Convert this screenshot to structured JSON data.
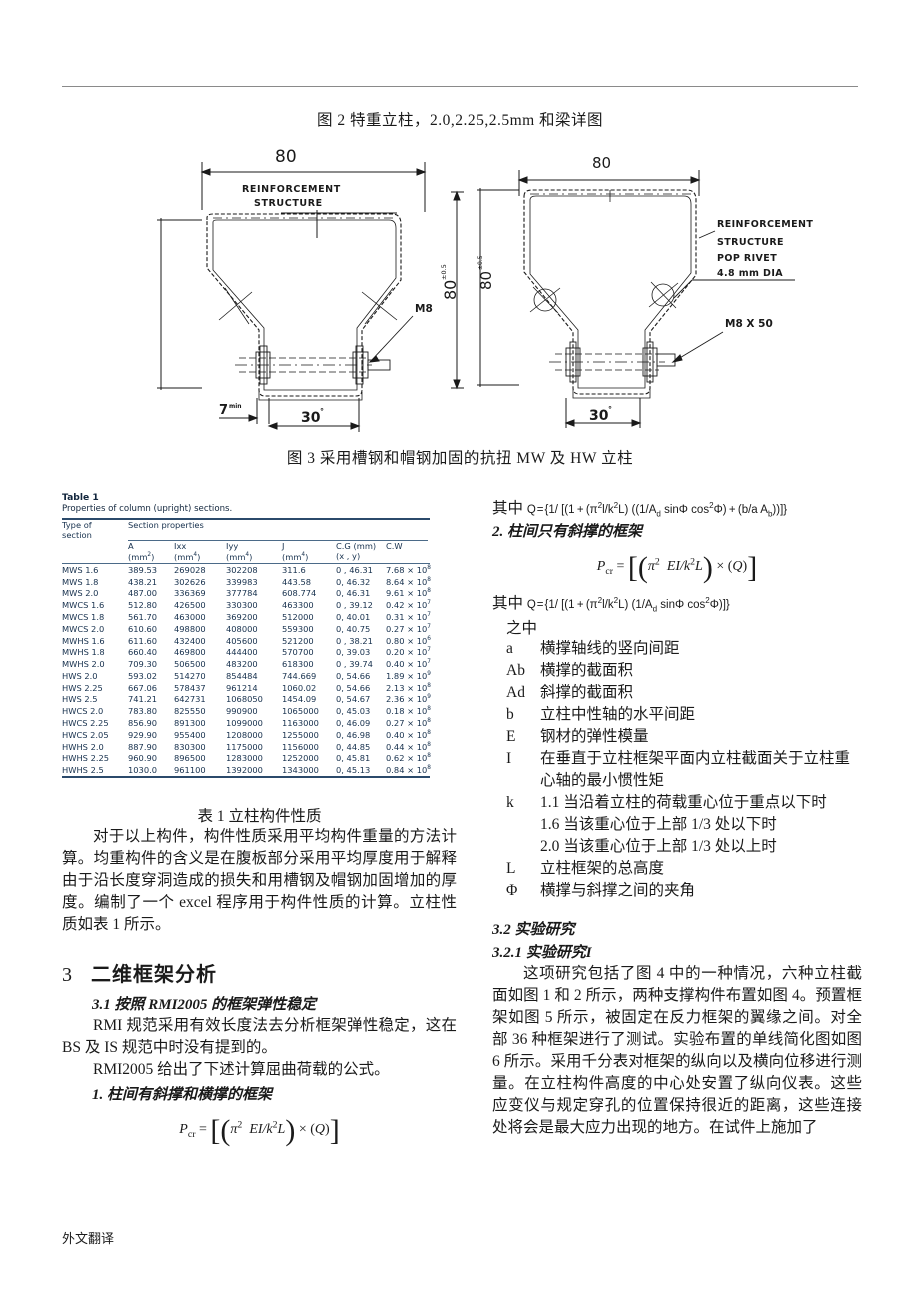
{
  "document": {
    "footer_label": "外文翻译"
  },
  "figures": {
    "fig2_caption": "图 2 特重立柱，2.0,2.25,2.5mm 和梁详图",
    "fig3_caption": "图 3 采用槽钢和帽钢加固的抗扭 MW 及 HW 立柱",
    "left_drawing": {
      "name": "MW 立柱断面图",
      "dim_top": "80",
      "dim_right": "80",
      "dim_right_sup": "±0.5",
      "label_reinforcement": "REINFORCEMENT",
      "label_structure": "STRUCTURE",
      "label_bolt": "M8",
      "dim_bottom_left": "7",
      "dim_bottom_left_sup": "min",
      "dim_bottom": "30",
      "dim_bottom_sup": "°"
    },
    "right_drawing": {
      "name": "HW 立柱断面图",
      "dim_top": "80",
      "dim_left": "80",
      "dim_left_sup": "±0.5",
      "label_reinforcement": "REINFORCEMENT",
      "label_structure": "STRUCTURE",
      "label_rivet": "POP RIVET",
      "label_rivet_dia": "4.8 mm DIA",
      "label_bolt": "M8 X 50",
      "dim_bottom": "30",
      "dim_bottom_sup": "°"
    }
  },
  "table1": {
    "label": "Table 1",
    "subtitle": "Properties of column (upright) sections.",
    "header_col0_line1": "Type of",
    "header_col0_line2": "section",
    "header_group": "Section properties",
    "columns": [
      {
        "sym": "A",
        "unit_pre": "(mm",
        "unit_sup": "2",
        "unit_post": ")"
      },
      {
        "sym": "Ixx",
        "unit_pre": "(mm",
        "unit_sup": "4",
        "unit_post": ")"
      },
      {
        "sym": "Iyy",
        "unit_pre": "(mm",
        "unit_sup": "4",
        "unit_post": ")"
      },
      {
        "sym": "J",
        "unit_pre": "(mm",
        "unit_sup": "4",
        "unit_post": ")"
      },
      {
        "sym": "C.G (mm)",
        "unit_pre": "(x , y)",
        "unit_sup": "",
        "unit_post": ""
      },
      {
        "sym": "C.W",
        "unit_pre": "",
        "unit_sup": "",
        "unit_post": ""
      }
    ],
    "rows": [
      {
        "type": "MWS 1.6",
        "a": "389.53",
        "ixx": "269028",
        "iyy": "302208",
        "j": "311.6",
        "cg": "0 , 46.31",
        "cw_m": "7.68",
        "cw_e": "8"
      },
      {
        "type": "MWS 1.8",
        "a": "438.21",
        "ixx": "302626",
        "iyy": "339983",
        "j": "443.58",
        "cg": "0, 46.32",
        "cw_m": "8.64",
        "cw_e": "8"
      },
      {
        "type": "MWS 2.0",
        "a": "487.00",
        "ixx": "336369",
        "iyy": "377784",
        "j": "608.774",
        "cg": "0, 46.31",
        "cw_m": "9.61",
        "cw_e": "8"
      },
      {
        "type": "MWCS 1.6",
        "a": "512.80",
        "ixx": "426500",
        "iyy": "330300",
        "j": "463300",
        "cg": "0 , 39.12",
        "cw_m": "0.42",
        "cw_e": "7"
      },
      {
        "type": "MWCS 1.8",
        "a": "561.70",
        "ixx": "463000",
        "iyy": "369200",
        "j": "512000",
        "cg": "0, 40.01",
        "cw_m": "0.31",
        "cw_e": "7"
      },
      {
        "type": "MWCS 2.0",
        "a": "610.60",
        "ixx": "498800",
        "iyy": "408000",
        "j": "559300",
        "cg": "0, 40.75",
        "cw_m": "0.27",
        "cw_e": "7"
      },
      {
        "type": "MWHS 1.6",
        "a": "611.60",
        "ixx": "432400",
        "iyy": "405600",
        "j": "521200",
        "cg": "0 , 38.21",
        "cw_m": "0.80",
        "cw_e": "6"
      },
      {
        "type": "MWHS 1.8",
        "a": "660.40",
        "ixx": "469800",
        "iyy": "444400",
        "j": "570700",
        "cg": "0, 39.03",
        "cw_m": "0.20",
        "cw_e": "7"
      },
      {
        "type": "MWHS 2.0",
        "a": "709.30",
        "ixx": "506500",
        "iyy": "483200",
        "j": "618300",
        "cg": "0 , 39.74",
        "cw_m": "0.40",
        "cw_e": "7"
      },
      {
        "type": "HWS 2.0",
        "a": "593.02",
        "ixx": "514270",
        "iyy": "854484",
        "j": "744.669",
        "cg": "0, 54.66",
        "cw_m": "1.89",
        "cw_e": "9"
      },
      {
        "type": "HWS 2.25",
        "a": "667.06",
        "ixx": "578437",
        "iyy": "961214",
        "j": "1060.02",
        "cg": "0, 54.66",
        "cw_m": "2.13",
        "cw_e": "8"
      },
      {
        "type": "HWS 2.5",
        "a": "741.21",
        "ixx": "642731",
        "iyy": "1068050",
        "j": "1454.09",
        "cg": "0, 54.67",
        "cw_m": "2.36",
        "cw_e": "9"
      },
      {
        "type": "HWCS 2.0",
        "a": "783.80",
        "ixx": "825550",
        "iyy": "990900",
        "j": "1065000",
        "cg": "0, 45.03",
        "cw_m": "0.18",
        "cw_e": "8"
      },
      {
        "type": "HWCS 2.25",
        "a": "856.90",
        "ixx": "891300",
        "iyy": "1099000",
        "j": "1163000",
        "cg": "0, 46.09",
        "cw_m": "0.27",
        "cw_e": "8"
      },
      {
        "type": "HWCS 2.05",
        "a": "929.90",
        "ixx": "955400",
        "iyy": "1208000",
        "j": "1255000",
        "cg": "0, 46.98",
        "cw_m": "0.40",
        "cw_e": "8"
      },
      {
        "type": "HWHS 2.0",
        "a": "887.90",
        "ixx": "830300",
        "iyy": "1175000",
        "j": "1156000",
        "cg": "0, 44.85",
        "cw_m": "0.44",
        "cw_e": "8"
      },
      {
        "type": "HWHS 2.25",
        "a": "960.90",
        "ixx": "896500",
        "iyy": "1283000",
        "j": "1252000",
        "cg": "0, 45.81",
        "cw_m": "0.62",
        "cw_e": "8"
      },
      {
        "type": "HWHS 2.5",
        "a": "1030.0",
        "ixx": "961100",
        "iyy": "1392000",
        "j": "1343000",
        "cg": "0, 45.13",
        "cw_m": "0.84",
        "cw_e": "8"
      }
    ]
  },
  "left_column": {
    "table_caption": "表 1 立柱构件性质",
    "para1": "对于以上构件，构件性质采用平均构件重量的方法计算。均重构件的含义是在腹板部分采用平均厚度用于解释由于沿长度穿洞造成的损失和用槽钢及帽钢加固增加的厚度。编制了一个 excel 程序用于构件性质的计算。立柱性质如表 1 所示。",
    "section_num": "3",
    "section_title": "二维框架分析",
    "subsection_31": "3.1 按照 RMI2005 的框架弹性稳定",
    "para2": "RMI 规范采用有效长度法去分析框架弹性稳定，这在 BS 及 IS 规范中时没有提到的。",
    "para3": "RMI2005 给出了下述计算屈曲荷载的公式。",
    "item1": "1. 柱间有斜撑和横撑的框架",
    "formula1": "Pcr = [ (π² EI/k²L) × (Q) ]"
  },
  "right_column": {
    "qizhong1_label": "其中",
    "qizhong1_formula": "Q = {1/ [(1 + (π²l/k²L) ((1/Ad sinΦ cos²Φ) + (b/a Ab))]}",
    "item2": "2. 柱间只有斜撑的框架",
    "formula2": "Pcr = [ (π² EI/k²L) × (Q) ]",
    "qizhong2_label": "其中",
    "qizhong2_formula": "Q = {1/ [(1 + (π²l/k²L) (1/Ad sinΦ cos²Φ)]}",
    "zhizhong": "之中",
    "definitions": [
      {
        "sym": "a",
        "desc": "横撑轴线的竖向间距"
      },
      {
        "sym": "Ab",
        "desc": "横撑的截面积"
      },
      {
        "sym": "Ad",
        "desc": "斜撑的截面积"
      },
      {
        "sym": "b",
        "desc": "立柱中性轴的水平间距"
      },
      {
        "sym": "E",
        "desc": "钢材的弹性模量"
      },
      {
        "sym": "I",
        "desc": "在垂直于立柱框架平面内立柱截面关于立柱重心轴的最小惯性矩"
      },
      {
        "sym": "k",
        "desc": "1.1 当沿着立柱的荷载重心位于重点以下时"
      },
      {
        "sym": "",
        "desc": "1.6 当该重心位于上部 1/3 处以下时"
      },
      {
        "sym": "",
        "desc": "2.0 当该重心位于上部 1/3 处以上时"
      },
      {
        "sym": "L",
        "desc": "立柱框架的总高度"
      },
      {
        "sym": "Φ",
        "desc": "横撑与斜撑之间的夹角"
      }
    ],
    "subsection_32": "3.2 实验研究",
    "subsection_321": "3.2.1 实验研究I",
    "para4": "这项研究包括了图 4 中的一种情况，六种立柱截面如图 1 和 2 所示，两种支撑构件布置如图 4。预置框架如图 5 所示，被固定在反力框架的翼缘之间。对全部 36 种框架进行了测试。实验布置的单线简化图如图 6 所示。采用千分表对框架的纵向以及横向位移进行测量。在立柱构件高度的中心处安置了纵向仪表。这些应变仪与规定穿孔的位置保持很近的距离，这些连接处将会是最大应力出现的地方。在试件上施加了"
  }
}
